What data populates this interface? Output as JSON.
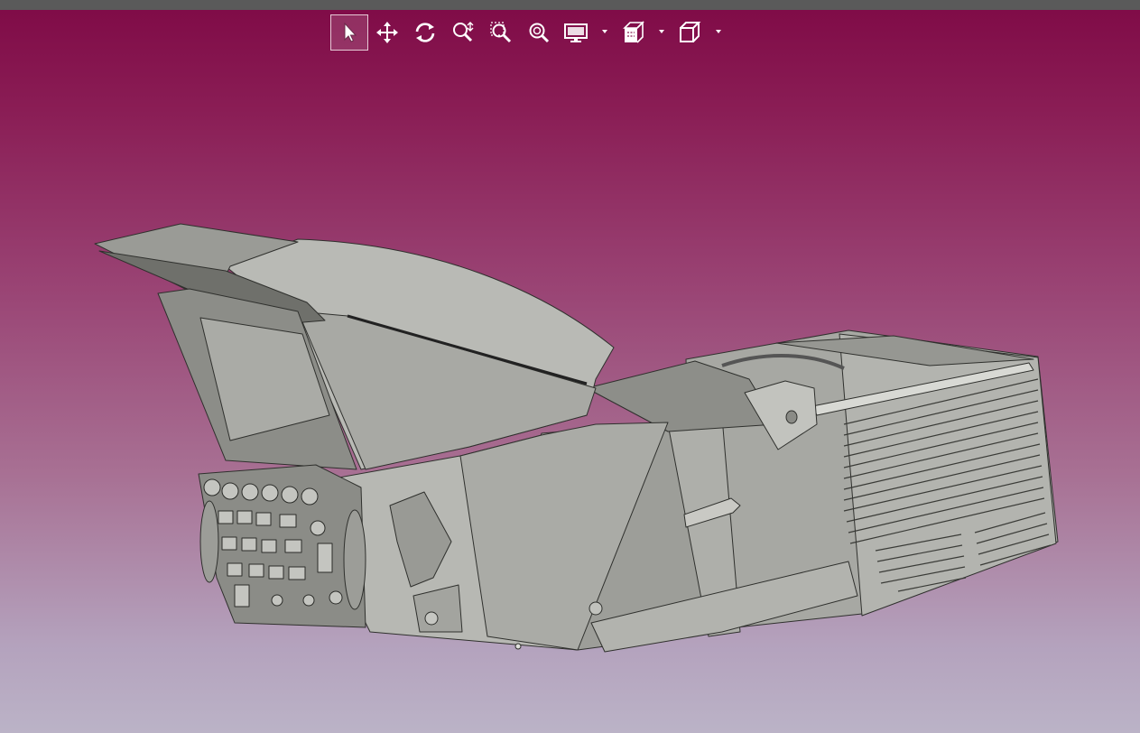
{
  "viewer": {
    "toolbar": {
      "tools": [
        {
          "name": "select",
          "icon": "cursor-icon",
          "selected": true
        },
        {
          "name": "pan",
          "icon": "move-arrows-icon",
          "selected": false
        },
        {
          "name": "rotate",
          "icon": "rotate-icon",
          "selected": false
        },
        {
          "name": "zoom",
          "icon": "zoom-icon",
          "selected": false
        },
        {
          "name": "zoom-window",
          "icon": "zoom-window-icon",
          "selected": false
        },
        {
          "name": "zoom-fit",
          "icon": "zoom-fit-icon",
          "selected": false
        },
        {
          "name": "display-mode",
          "icon": "monitor-icon",
          "selected": false,
          "dropdown": true
        },
        {
          "name": "section-view",
          "icon": "section-icon",
          "selected": false,
          "dropdown": true
        },
        {
          "name": "standard-views",
          "icon": "cube-icon",
          "selected": false,
          "dropdown": true
        }
      ]
    },
    "background": {
      "top_color": "#7f0a46",
      "bottom_color": "#bbb3c7"
    },
    "model": {
      "description_icon": "cad-assembly-model",
      "shade_color": "#a9aaa5"
    }
  }
}
